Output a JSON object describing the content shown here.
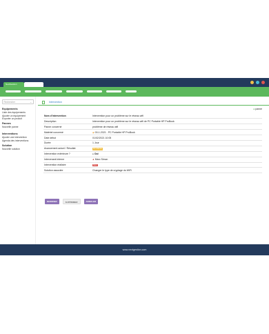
{
  "window": {
    "tab_label": "NextGestion",
    "dot_colors": [
      "#f0c04a",
      "#48b8d9",
      "#e0564f"
    ]
  },
  "sidebar": {
    "search_placeholder": "Rechercher",
    "sections": [
      {
        "title": "Equipements",
        "links": [
          "Liste des équipements",
          "Ajouter un équipement",
          "Exporter un produit"
        ]
      },
      {
        "title": "Pannes",
        "links": [
          "Nouvelle panne"
        ]
      },
      {
        "title": "Interventions",
        "links": [
          "Ajouter une intervention",
          "Agenda des interventions"
        ]
      },
      {
        "title": "Solution",
        "links": [
          "Nouvelle solution"
        ]
      }
    ]
  },
  "main": {
    "breadcrumb": "Intervention",
    "top_right_label": "panne",
    "rows": [
      {
        "label": "Nom d'intervention",
        "value": "Intervention pour un problème sur le réseau wifi"
      },
      {
        "label": "Description",
        "value": "Intervention pour un problème sur le réseau wifi de PC Portable HP ProBook"
      },
      {
        "label": "Panne concerné",
        "value": "problème de réseau wifi"
      },
      {
        "label": "Matériel concerné",
        "value": "00-1-2021 - PC Portable HP ProBook"
      },
      {
        "label": "Date début",
        "value": "01/02/2021 10:05"
      },
      {
        "label": "Durée",
        "value": "1 Jour"
      },
      {
        "label": "Avancement actuel / Résultat",
        "value": "En attente"
      },
      {
        "label": "Intervention extérieure ?",
        "value": "Oui"
      },
      {
        "label": "Intervenant interne",
        "value": "Marc Simon"
      },
      {
        "label": "Intervention réalisée",
        "value": "Non"
      },
      {
        "label": "Solution associée",
        "value": "Changer le type de cryptage du WiFi"
      }
    ],
    "badge_colors": {
      "status": "#f0c04a",
      "no": "#d9534f"
    },
    "buttons": {
      "modify": "Modifier",
      "delete": "Supprimer",
      "cancel": "Annuler"
    }
  },
  "footer": {
    "url": "www.nextgestion.com"
  }
}
